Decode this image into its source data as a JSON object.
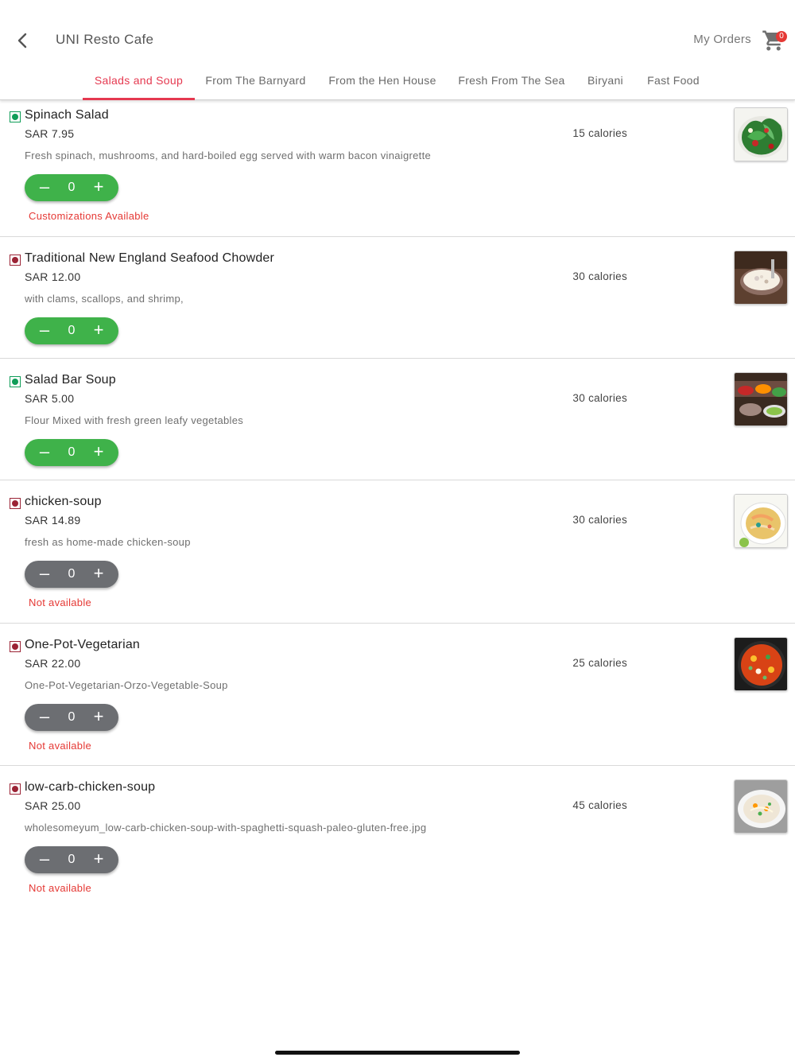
{
  "header": {
    "title": "UNI Resto Cafe",
    "my_orders": "My Orders",
    "cart_count": "0",
    "accent_color": "#e53950"
  },
  "tabs": [
    {
      "label": "Salads and Soup",
      "active": true
    },
    {
      "label": "From The Barnyard",
      "active": false
    },
    {
      "label": "From the Hen House",
      "active": false
    },
    {
      "label": "Fresh From The Sea",
      "active": false
    },
    {
      "label": "Biryani",
      "active": false
    },
    {
      "label": "Fast Food",
      "active": false
    }
  ],
  "items": [
    {
      "name": "Spinach Salad",
      "price": "SAR 7.95",
      "description": "Fresh spinach, mushrooms, and hard-boiled egg served with warm bacon vinaigrette",
      "calories": "15 calories",
      "quantity": "0",
      "veg": true,
      "available": true,
      "note": "Customizations Available"
    },
    {
      "name": "Traditional New England Seafood Chowder",
      "price": "SAR 12.00",
      "description": "with clams, scallops, and shrimp,",
      "calories": "30 calories",
      "quantity": "0",
      "veg": false,
      "available": true,
      "note": ""
    },
    {
      "name": "Salad Bar Soup",
      "price": "SAR 5.00",
      "description": "Flour Mixed with fresh green leafy vegetables",
      "calories": "30 calories",
      "quantity": "0",
      "veg": true,
      "available": true,
      "note": ""
    },
    {
      "name": "chicken-soup",
      "price": "SAR 14.89",
      "description": "fresh as home-made chicken-soup",
      "calories": "30 calories",
      "quantity": "0",
      "veg": false,
      "available": false,
      "note": "Not available"
    },
    {
      "name": "One-Pot-Vegetarian",
      "price": "SAR 22.00",
      "description": "One-Pot-Vegetarian-Orzo-Vegetable-Soup",
      "calories": "25 calories",
      "quantity": "0",
      "veg": false,
      "available": false,
      "note": "Not available"
    },
    {
      "name": "low-carb-chicken-soup",
      "price": "SAR 25.00",
      "description": "wholesomeyum_low-carb-chicken-soup-with-spaghetti-squash-paleo-gluten-free.jpg",
      "calories": "45 calories",
      "quantity": "0",
      "veg": false,
      "available": false,
      "note": "Not available"
    }
  ],
  "colors": {
    "veg": "#0f9d58",
    "nonveg": "#9b2335",
    "stepper_available": "#3fb24a",
    "stepper_unavailable": "#6c6e72",
    "note": "#e53935"
  },
  "icons": {
    "back": "chevron-left-icon",
    "cart": "shopping-cart-icon",
    "decrement": "minus-icon",
    "increment": "plus-icon"
  }
}
